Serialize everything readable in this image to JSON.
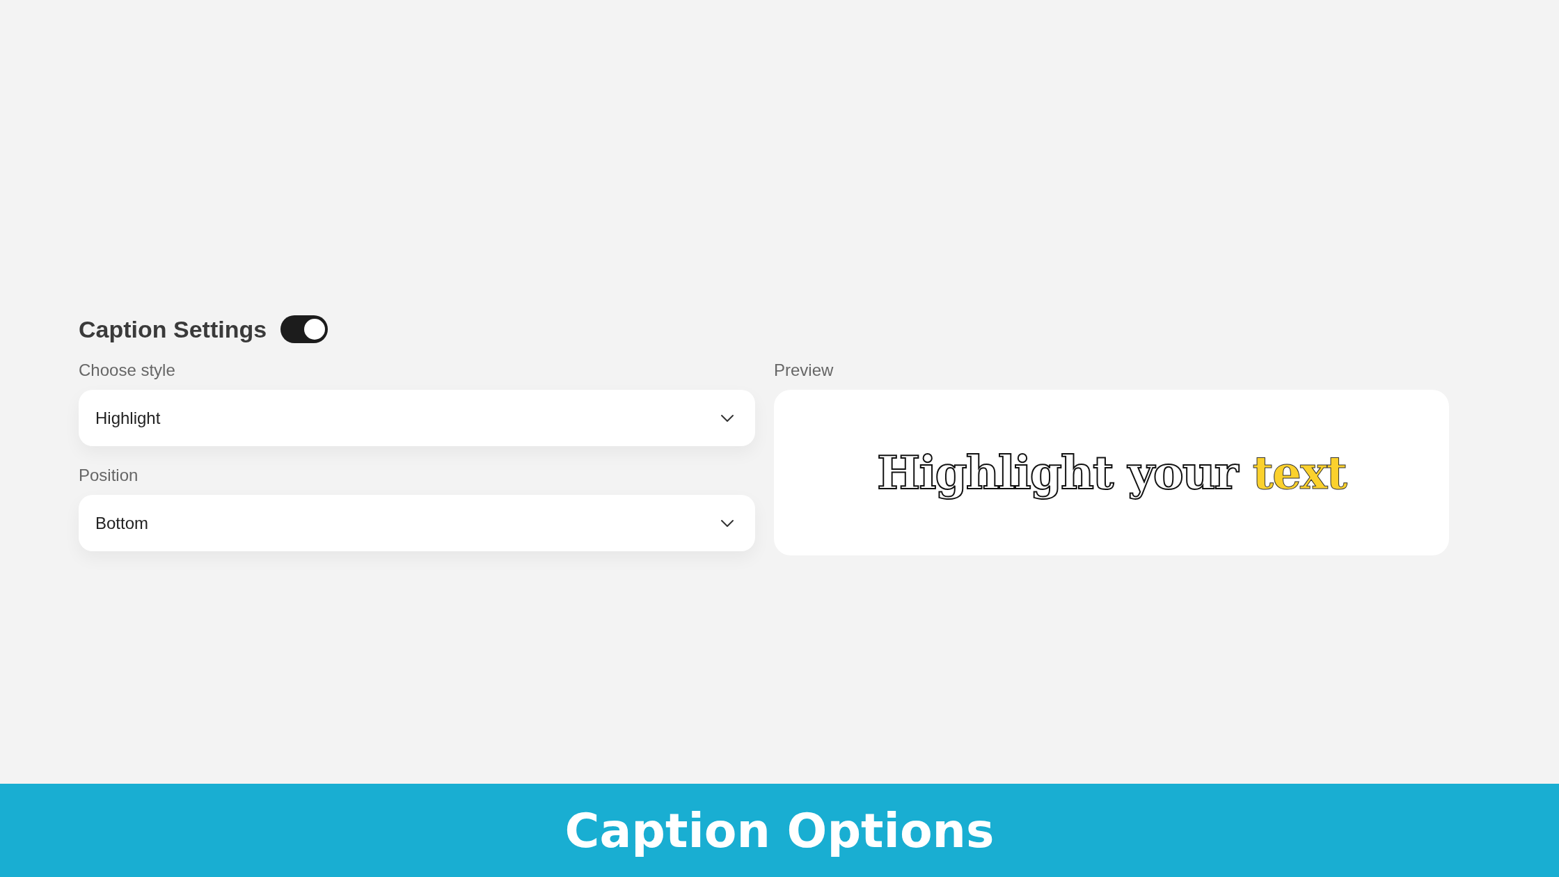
{
  "settings": {
    "title": "Caption Settings",
    "enabled": true
  },
  "fields": [
    {
      "label": "Choose style",
      "value": "Highlight"
    },
    {
      "label": "Position",
      "value": "Bottom"
    }
  ],
  "preview": {
    "label": "Preview",
    "words": [
      {
        "text": "Highlight",
        "highlighted": false
      },
      {
        "text": "your",
        "highlighted": false
      },
      {
        "text": "text",
        "highlighted": true
      }
    ]
  },
  "banner": {
    "title": "Caption Options"
  }
}
